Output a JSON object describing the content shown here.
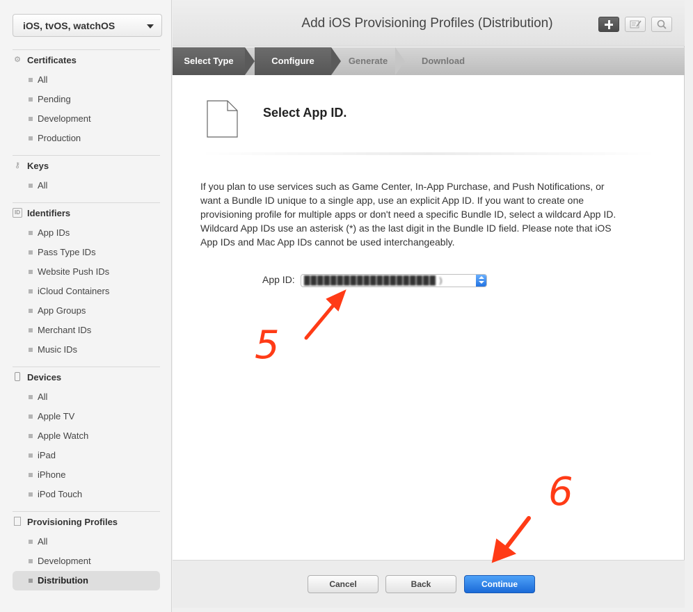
{
  "sidebar": {
    "platform": "iOS, tvOS, watchOS",
    "sections": [
      {
        "title": "Certificates",
        "icon": "gear-icon",
        "items": [
          "All",
          "Pending",
          "Development",
          "Production"
        ]
      },
      {
        "title": "Keys",
        "icon": "key-icon",
        "items": [
          "All"
        ]
      },
      {
        "title": "Identifiers",
        "icon": "id-icon",
        "items": [
          "App IDs",
          "Pass Type IDs",
          "Website Push IDs",
          "iCloud Containers",
          "App Groups",
          "Merchant IDs",
          "Music IDs"
        ]
      },
      {
        "title": "Devices",
        "icon": "device-icon",
        "items": [
          "All",
          "Apple TV",
          "Apple Watch",
          "iPad",
          "iPhone",
          "iPod Touch"
        ]
      },
      {
        "title": "Provisioning Profiles",
        "icon": "document-icon",
        "items": [
          "All",
          "Development",
          "Distribution"
        ]
      }
    ],
    "active_item": "Provisioning Profiles / Distribution"
  },
  "header": {
    "title": "Add iOS Provisioning Profiles (Distribution)",
    "buttons": [
      "add-icon",
      "edit-icon",
      "search-icon"
    ]
  },
  "steps": [
    "Select Type",
    "Configure",
    "Generate",
    "Download"
  ],
  "content": {
    "title": "Select App ID.",
    "description": "If you plan to use services such as Game Center, In-App Purchase, and Push Notifications, or want a Bundle ID unique to a single app, use an explicit App ID. If you want to create one provisioning profile for multiple apps or don't need a specific Bundle ID, select a wildcard App ID. Wildcard App IDs use an asterisk (*) as the last digit in the Bundle ID field. Please note that iOS App IDs and Mac App IDs cannot be used interchangeably.",
    "app_id_label": "App ID:",
    "app_id_value": "████████████████████ )"
  },
  "footer": {
    "cancel": "Cancel",
    "back": "Back",
    "continue": "Continue"
  },
  "annotations": {
    "step5": "5",
    "step6": "6",
    "color": "#ff3b16"
  },
  "colors": {
    "accent": "#1b6ad8",
    "sidebar_bg": "#f4f4f4",
    "step_done": "#5f5f5f"
  }
}
